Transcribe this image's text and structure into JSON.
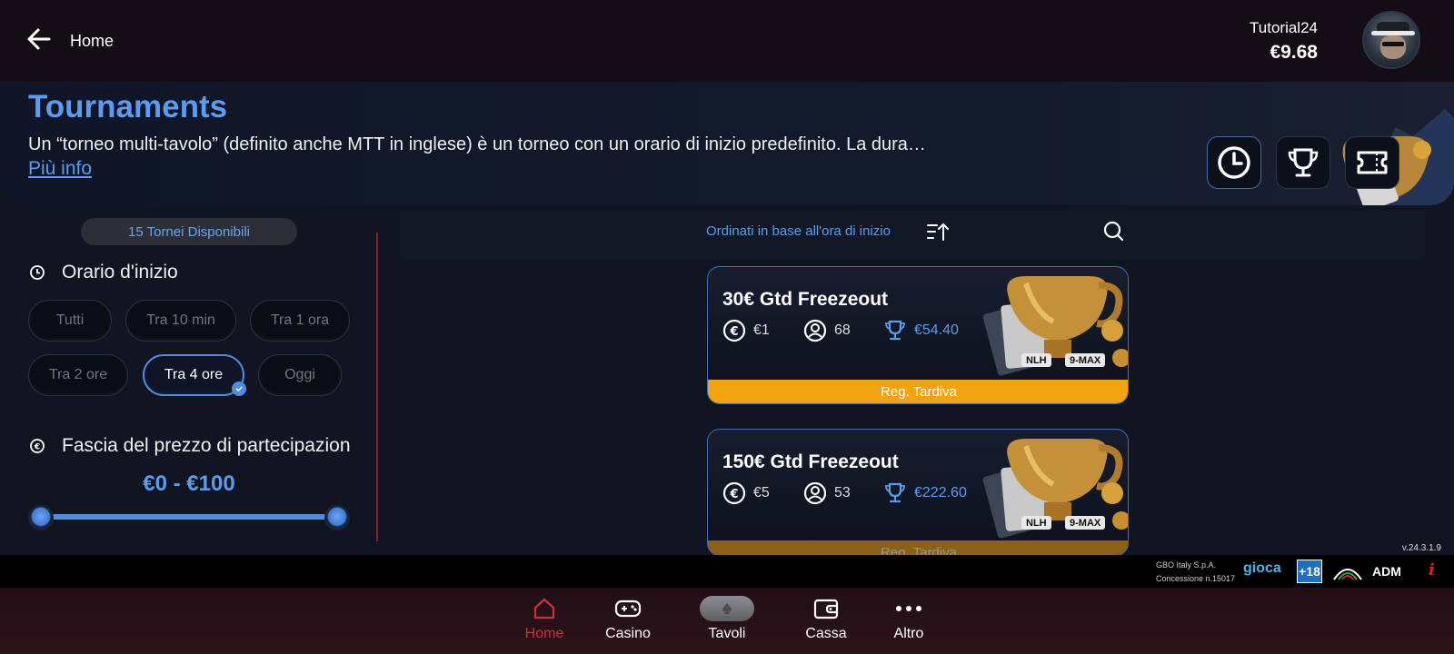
{
  "topbar": {
    "back_label": "Home",
    "user_name": "Tutorial24",
    "balance": "€9.68"
  },
  "banner": {
    "title": "Tournaments",
    "description": "Un “torneo multi-tavolo” (definito anche MTT in inglese) è un torneo con un orario di inizio predefinito. La dura…",
    "link": "Più info",
    "tiles": [
      "clock-icon",
      "trophy-icon",
      "ticket-icon"
    ]
  },
  "filters": {
    "count_label": "15 Tornei Disponibili",
    "start_time": {
      "title": "Orario d'inizio",
      "options": [
        "Tutti",
        "Tra 10 min",
        "Tra 1 ora",
        "Tra 2 ore",
        "Tra 4 ore",
        "Oggi"
      ],
      "selected": "Tra 4 ore"
    },
    "price": {
      "title": "Fascia del prezzo di partecipazion",
      "range_label": "€0 - €100",
      "min": 0,
      "max": 100
    }
  },
  "list": {
    "sort_label": "Ordinati in base all'ora di inizio",
    "tournaments": [
      {
        "name": "30€ Gtd Freezeout",
        "buyin": "€1",
        "players": "68",
        "prize": "€54.40",
        "tags": [
          "NLH",
          "9-MAX"
        ],
        "status": "Reg. Tardiva"
      },
      {
        "name": "150€ Gtd Freezeout",
        "buyin": "€5",
        "players": "53",
        "prize": "€222.60",
        "tags": [
          "NLH",
          "9-MAX"
        ],
        "status": "Reg. Tardiva"
      }
    ]
  },
  "footer": {
    "version": "v.24.3.1.9",
    "company_line1": "GBO Italy S.p.A.",
    "company_line2": "Concessione n.15017",
    "gioca_logo": "gioca",
    "age_logo": "+18",
    "adm_logo": "ADM",
    "info_symbol": "i"
  },
  "nav": {
    "items": [
      "Home",
      "Casino",
      "Tavoli",
      "Cassa",
      "Altro"
    ],
    "active": "Home"
  },
  "colors": {
    "accent": "#5a9df0",
    "late_reg": "#f3a30f",
    "nav_active": "#c8333a"
  }
}
